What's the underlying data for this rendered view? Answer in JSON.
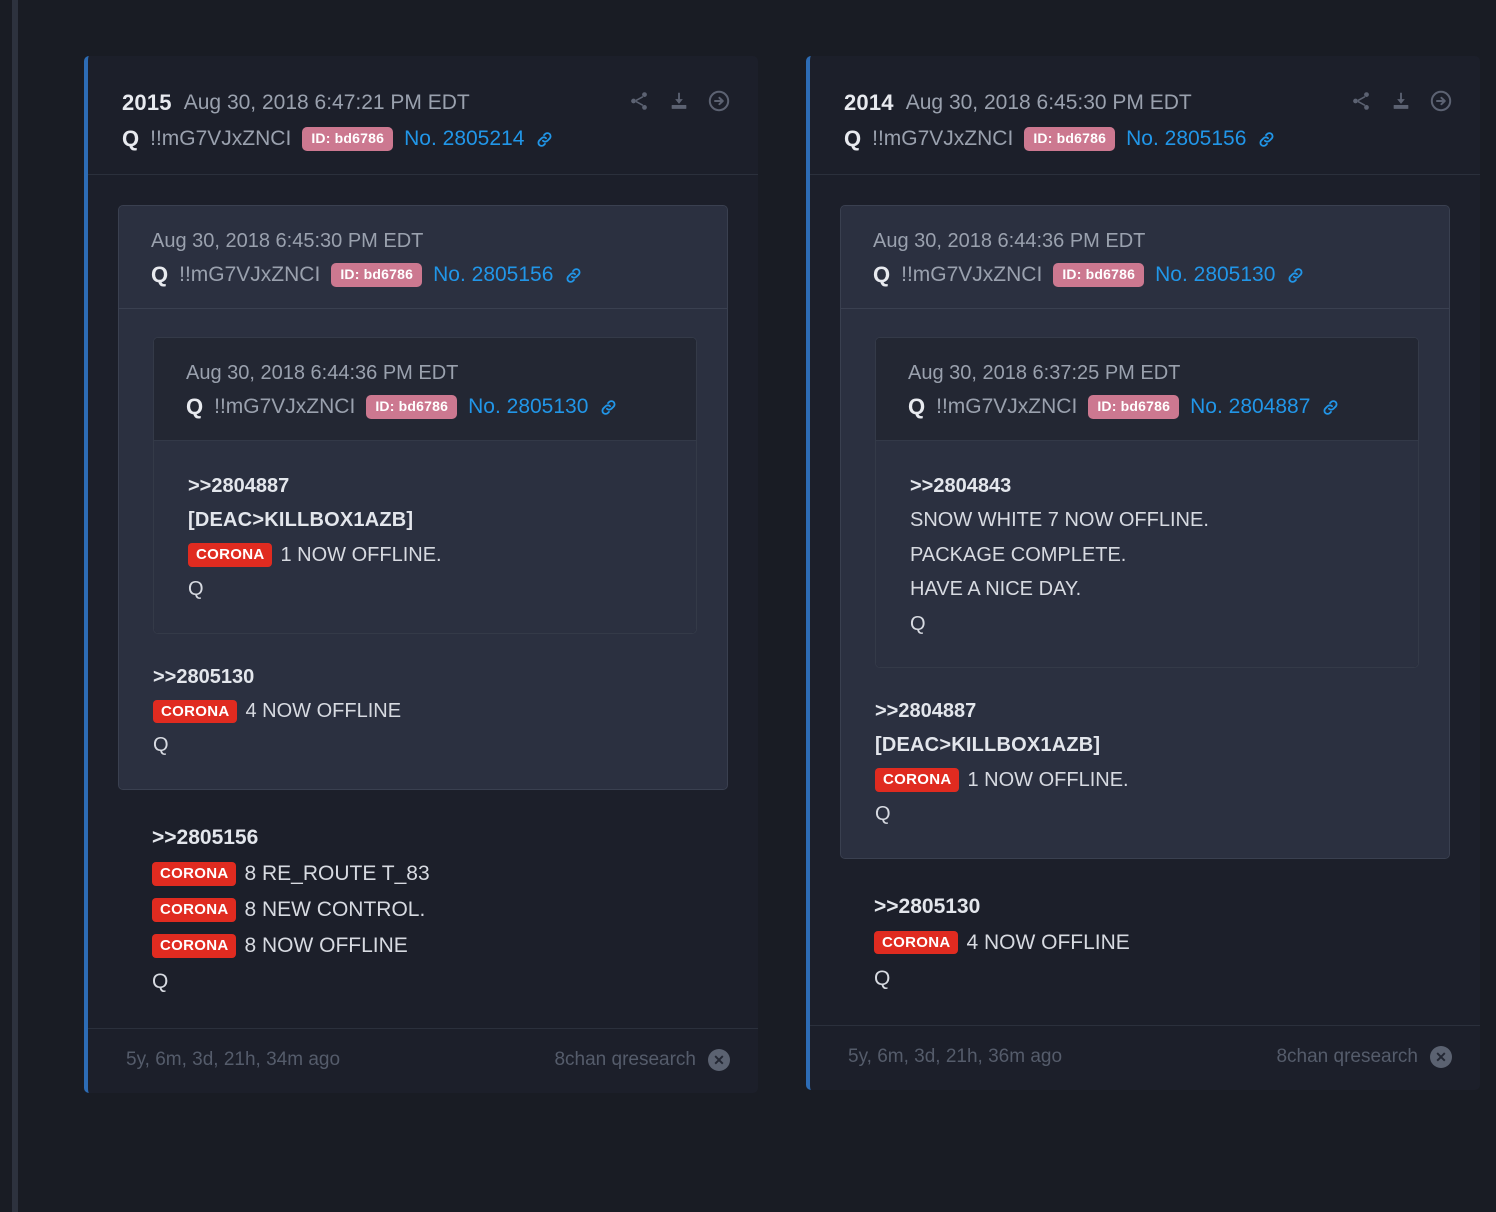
{
  "theme": {
    "page_bg": "#191c24",
    "card_bg": "#1c1f2a",
    "quote_bg": "#2b3040",
    "accent_bar": "#2d6cb5",
    "link_blue": "#2196e8",
    "id_badge_bg": "#cc7890",
    "corona_badge_bg": "#e02b20"
  },
  "icons": {
    "share": "share-icon",
    "download": "download-icon",
    "open": "arrow-right-circle-icon",
    "chain": "chain-link-icon",
    "close": "close-circle-icon"
  },
  "cards": [
    {
      "index": "2015",
      "date": "Aug 30, 2018 6:47:21 PM EDT",
      "q": "Q",
      "tripcode": "!!mG7VJxZNCI",
      "id_badge": "ID: bd6786",
      "post_no": "No. 2805214",
      "quote": {
        "date": "Aug 30, 2018 6:45:30 PM EDT",
        "q": "Q",
        "tripcode": "!!mG7VJxZNCI",
        "id_badge": "ID: bd6786",
        "post_no": "No. 2805156",
        "quote": {
          "date": "Aug 30, 2018 6:44:36 PM EDT",
          "q": "Q",
          "tripcode": "!!mG7VJxZNCI",
          "id_badge": "ID: bd6786",
          "post_no": "No. 2805130",
          "lines": [
            {
              "type": "ref",
              "text": ">>2804887"
            },
            {
              "type": "strong",
              "text": "[DEAC>KILLBOX1AZB]"
            },
            {
              "type": "corona",
              "badge": "CORONA",
              "text": "1 NOW OFFLINE."
            },
            {
              "type": "plain",
              "text": "Q"
            }
          ]
        },
        "lines": [
          {
            "type": "ref",
            "text": ">>2805130"
          },
          {
            "type": "corona",
            "badge": "CORONA",
            "text": "4 NOW OFFLINE"
          },
          {
            "type": "plain",
            "text": "Q"
          }
        ]
      },
      "lines": [
        {
          "type": "ref",
          "text": ">>2805156"
        },
        {
          "type": "corona",
          "badge": "CORONA",
          "text": "8 RE_ROUTE T_83"
        },
        {
          "type": "corona",
          "badge": "CORONA",
          "text": "8 NEW CONTROL."
        },
        {
          "type": "corona",
          "badge": "CORONA",
          "text": "8 NOW OFFLINE"
        },
        {
          "type": "plain",
          "text": "Q"
        }
      ],
      "footer": {
        "ago": "5y, 6m, 3d, 21h, 34m ago",
        "source": "8chan qresearch"
      }
    },
    {
      "index": "2014",
      "date": "Aug 30, 2018 6:45:30 PM EDT",
      "q": "Q",
      "tripcode": "!!mG7VJxZNCI",
      "id_badge": "ID: bd6786",
      "post_no": "No. 2805156",
      "quote": {
        "date": "Aug 30, 2018 6:44:36 PM EDT",
        "q": "Q",
        "tripcode": "!!mG7VJxZNCI",
        "id_badge": "ID: bd6786",
        "post_no": "No. 2805130",
        "quote": {
          "date": "Aug 30, 2018 6:37:25 PM EDT",
          "q": "Q",
          "tripcode": "!!mG7VJxZNCI",
          "id_badge": "ID: bd6786",
          "post_no": "No. 2804887",
          "lines": [
            {
              "type": "ref",
              "text": ">>2804843"
            },
            {
              "type": "plain",
              "text": "SNOW WHITE 7 NOW OFFLINE."
            },
            {
              "type": "plain",
              "text": "PACKAGE COMPLETE."
            },
            {
              "type": "plain",
              "text": "HAVE A NICE DAY."
            },
            {
              "type": "plain",
              "text": "Q"
            }
          ]
        },
        "lines": [
          {
            "type": "ref",
            "text": ">>2804887"
          },
          {
            "type": "strong",
            "text": "[DEAC>KILLBOX1AZB]"
          },
          {
            "type": "corona",
            "badge": "CORONA",
            "text": "1 NOW OFFLINE."
          },
          {
            "type": "plain",
            "text": "Q"
          }
        ]
      },
      "lines": [
        {
          "type": "ref",
          "text": ">>2805130"
        },
        {
          "type": "corona",
          "badge": "CORONA",
          "text": "4 NOW OFFLINE"
        },
        {
          "type": "plain",
          "text": "Q"
        }
      ],
      "footer": {
        "ago": "5y, 6m, 3d, 21h, 36m ago",
        "source": "8chan qresearch"
      }
    }
  ]
}
